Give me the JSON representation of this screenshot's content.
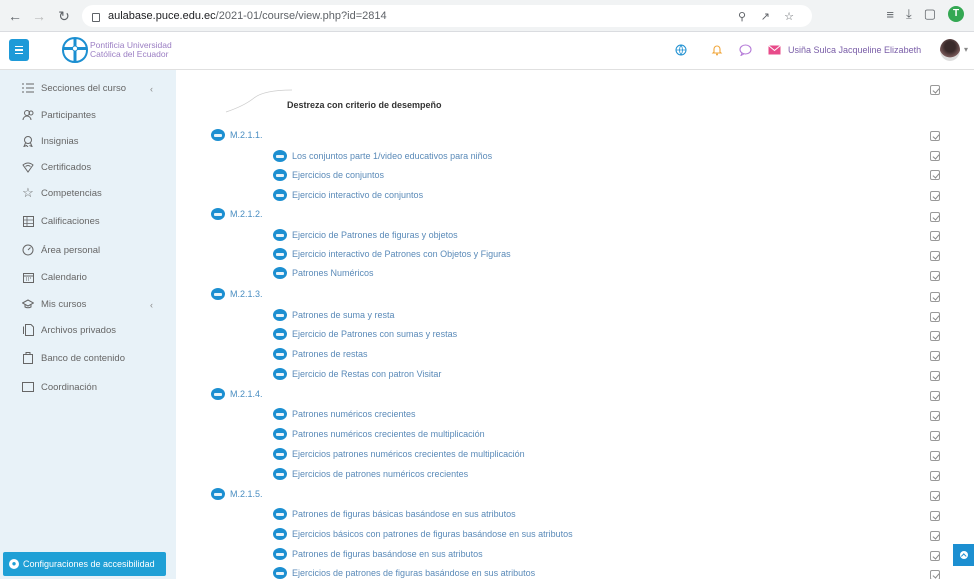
{
  "browser": {
    "url_host": "aulabase.puce.edu.ec",
    "url_path": "/2021-01/course/view.php?id=2814",
    "profile_initial": "T"
  },
  "header": {
    "logo_line1": "Pontificia Universidad",
    "logo_line2": "Católica del Ecuador",
    "username": "Usiña Sulca Jacqueline Elizabeth"
  },
  "sidebar": {
    "items": [
      {
        "label": "Secciones del curso",
        "icon": "list-icon"
      },
      {
        "label": "Participantes",
        "icon": "users-icon"
      },
      {
        "label": "Insignias",
        "icon": "badge-icon"
      },
      {
        "label": "Certificados",
        "icon": "certificate-icon"
      },
      {
        "label": "Competencias",
        "icon": "star-icon"
      },
      {
        "label": "Calificaciones",
        "icon": "table-icon"
      },
      {
        "label": "Área personal",
        "icon": "dashboard-icon"
      },
      {
        "label": "Calendario",
        "icon": "calendar-icon"
      },
      {
        "label": "Mis cursos",
        "icon": "graduation-icon"
      },
      {
        "label": "Archivos privados",
        "icon": "file-icon"
      },
      {
        "label": "Banco de contenido",
        "icon": "bank-icon"
      },
      {
        "label": "Coordinación",
        "icon": "folder-icon"
      }
    ],
    "accessibility_label": "Configuraciones de accesibilidad"
  },
  "course": {
    "title": "Destreza con criterio de desempeño",
    "sections": [
      {
        "code": "M.2.1.1.",
        "items": [
          "Los conjuntos parte 1/video educativos para niños",
          "Ejercicios de conjuntos",
          "Ejercicio interactivo de conjuntos"
        ]
      },
      {
        "code": "M.2.1.2.",
        "items": [
          "Ejercicio de Patrones de figuras y objetos",
          "Ejercicio interactivo de Patrones con Objetos y Figuras",
          "Patrones Numéricos"
        ]
      },
      {
        "code": "M.2.1.3.",
        "items": [
          "Patrones de suma y resta",
          "Ejercicio de Patrones con sumas y restas",
          "Patrones de restas",
          "Ejercicio de Restas con patron Visitar"
        ]
      },
      {
        "code": "M.2.1.4.",
        "items": [
          "Patrones numéricos crecientes",
          "Patrones numéricos crecientes de multiplicación",
          "Ejercicios patrones numéricos crecientes de multiplicación",
          "Ejercicios de patrones numéricos crecientes"
        ]
      },
      {
        "code": "M.2.1.5.",
        "items": [
          "Patrones de figuras básicas basándose en sus atributos",
          "Ejercicios básicos con patrones de figuras basándose en sus atributos",
          "Patrones de figuras basándose en sus atributos",
          "Ejercicios de patrones de figuras basándose en sus atributos"
        ]
      }
    ]
  },
  "colors": {
    "accent": "#1c8fd1",
    "sidebar_bg": "#e8f2f8",
    "link": "#5a8ab8"
  }
}
